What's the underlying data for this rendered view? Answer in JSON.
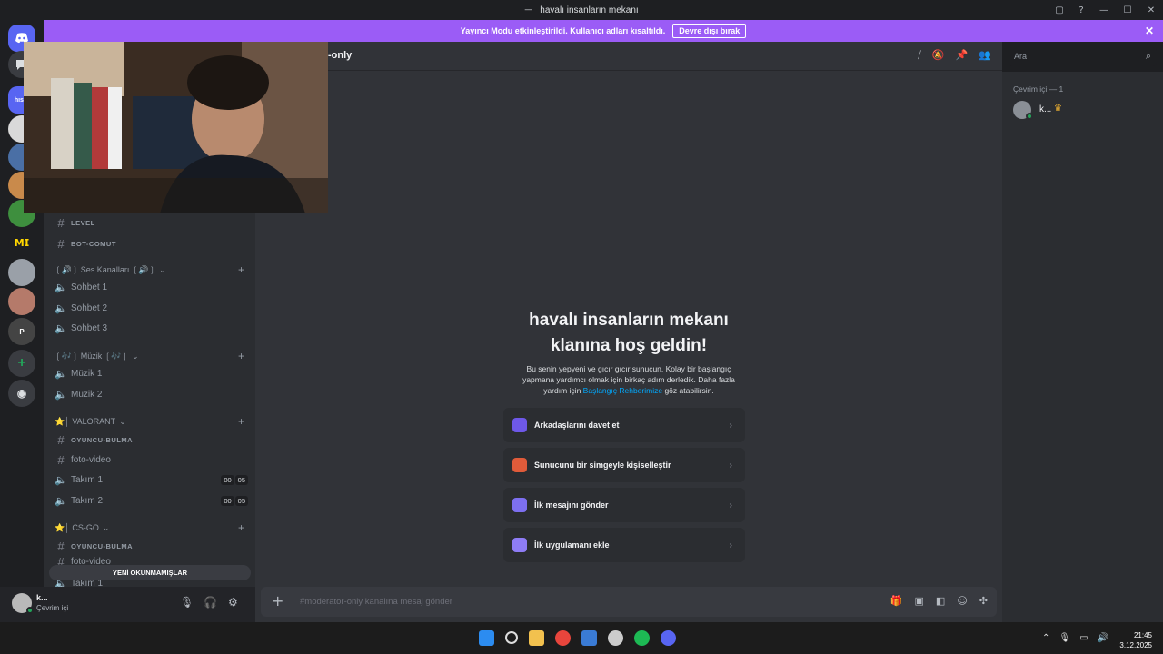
{
  "window": {
    "title": "havalı insanların mekanı",
    "controls": [
      "▢",
      "?",
      "—",
      "☐",
      "✕"
    ]
  },
  "banner": {
    "text": "Yayıncı Modu etkinleştirildi. Kullanıcı adları kısaltıldı.",
    "button": "Devre dışı bırak",
    "close": "✕"
  },
  "guilds": [
    "hısm",
    "𝗠𝗜",
    "P"
  ],
  "sidebar": {
    "channels_top": [
      {
        "name": "LEVEL"
      },
      {
        "name": "BOT-COMUT"
      }
    ],
    "categories": [
      {
        "label": "❲🔊❳ Ses Kanalları ❲🔊❳",
        "items": [
          "Sohbet 1",
          "Sohbet 2",
          "Sohbet 3"
        ]
      },
      {
        "label": "❲🎶❳ Müzik ❲🎶❳",
        "items": [
          "Müzik 1",
          "Müzik 2"
        ]
      },
      {
        "label": "⭐│ VALORANT",
        "items": [
          "OYUNCU-BULMA",
          "foto-video",
          "Takım 1",
          "Takım 2"
        ]
      },
      {
        "label": "⭐│ CS-GO",
        "items": [
          "OYUNCU-BULMA",
          "foto-video",
          "Takım 1"
        ]
      }
    ],
    "badges": {
      "left": "00",
      "right": "05"
    },
    "unread_pill": "YENİ OKUNMAMIŞLAR"
  },
  "user": {
    "name": "k...",
    "status": "Çevrim içi"
  },
  "channel": {
    "name": "-only"
  },
  "search": {
    "placeholder": "Ara"
  },
  "members": {
    "header": "Çevrim içi — 1",
    "list": [
      {
        "name": "k..."
      }
    ]
  },
  "welcome": {
    "title_line1": "havalı insanların mekanı",
    "title_line2": "klanına hoş geldin!",
    "desc_line1": "Bu senin yepyeni ve gıcır gıcır sunucun. Kolay bir başlangıç",
    "desc_line2": "yapmana yardımcı olmak için birkaç adım derledik. Daha fazla",
    "desc_pre": "yardım için",
    "desc_link": "Başlangıç Rehberimize",
    "desc_post": "göz atabilirsin.",
    "actions": [
      {
        "label": "Arkadaşlarını davet et",
        "color": "#6e58e8"
      },
      {
        "label": "Sunucunu bir simgeyle kişiselleştir",
        "color": "#e05b3a"
      },
      {
        "label": "İlk mesajını gönder",
        "color": "#7d6ff0"
      },
      {
        "label": "İlk uygulamanı ekle",
        "color": "#8e7cf5"
      }
    ]
  },
  "composer": {
    "placeholder": "#moderator-only kanalına mesaj gönder"
  },
  "clock": {
    "time": "21:45",
    "date": "3.12.2025"
  },
  "colors": {
    "accent": "#9b5cf6",
    "online": "#23a55a",
    "link": "#00a8fc"
  }
}
